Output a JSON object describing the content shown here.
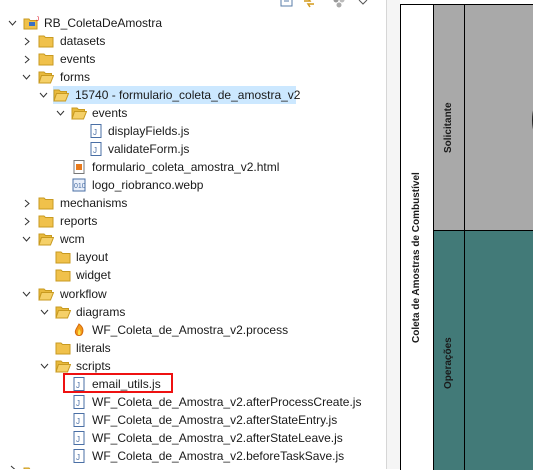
{
  "explorer": {
    "toolbar_icons": [
      "collapse-all-icon",
      "link-with-editor-icon",
      "filters-icon",
      "view-menu-icon"
    ],
    "project": {
      "label": "RB_ColetaDeAmostra"
    },
    "datasets": {
      "label": "datasets"
    },
    "events_root": {
      "label": "events"
    },
    "forms": {
      "label": "forms"
    },
    "form_folder": {
      "label": "15740 - formulario_coleta_de_amostra_v2"
    },
    "form_events": {
      "label": "events"
    },
    "display_fields": {
      "label": "displayFields.js"
    },
    "validate_form": {
      "label": "validateForm.js"
    },
    "form_html": {
      "label": "formulario_coleta_amostra_v2.html"
    },
    "logo": {
      "label": "logo_riobranco.webp"
    },
    "mechanisms": {
      "label": "mechanisms"
    },
    "reports": {
      "label": "reports"
    },
    "wcm": {
      "label": "wcm"
    },
    "layout": {
      "label": "layout"
    },
    "widget": {
      "label": "widget"
    },
    "workflow": {
      "label": "workflow"
    },
    "diagrams": {
      "label": "diagrams"
    },
    "process": {
      "label": "WF_Coleta_de_Amostra_v2.process"
    },
    "literals": {
      "label": "literals"
    },
    "scripts": {
      "label": "scripts"
    },
    "email_utils": {
      "label": "email_utils.js"
    },
    "after_process_create": {
      "label": "WF_Coleta_de_Amostra_v2.afterProcessCreate.js"
    },
    "after_state_entry": {
      "label": "WF_Coleta_de_Amostra_v2.afterStateEntry.js"
    },
    "after_state_leave": {
      "label": "WF_Coleta_de_Amostra_v2.afterStateLeave.js"
    },
    "before_task_save": {
      "label": "WF_Coleta_de_Amostra_v2.beforeTaskSave.js"
    }
  },
  "diagram": {
    "pool_label": "Coleta de Amostras de Combustível",
    "lane_solicitante": "Solicitante",
    "lane_operacoes": "Operações"
  },
  "colors": {
    "folder": "#f0c14b",
    "selection": "#cce8ff",
    "highlight": "#e11111",
    "lane_solicitante": "#a9a9a9",
    "lane_operacoes": "#427a78"
  }
}
